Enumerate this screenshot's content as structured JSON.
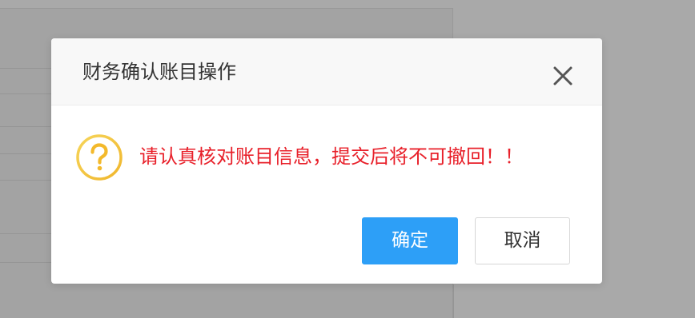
{
  "dialog": {
    "title": "财务确认账目操作",
    "close_icon": "close-icon",
    "message": "请认真核对账目信息，提交后将不可撤回！！",
    "message_icon": "question-icon",
    "confirm_label": "确定",
    "cancel_label": "取消"
  },
  "colors": {
    "message": "#e8202a",
    "primary_button": "#2d9ff7",
    "icon": "#f3c230",
    "overlay": "#a9a9a9"
  }
}
